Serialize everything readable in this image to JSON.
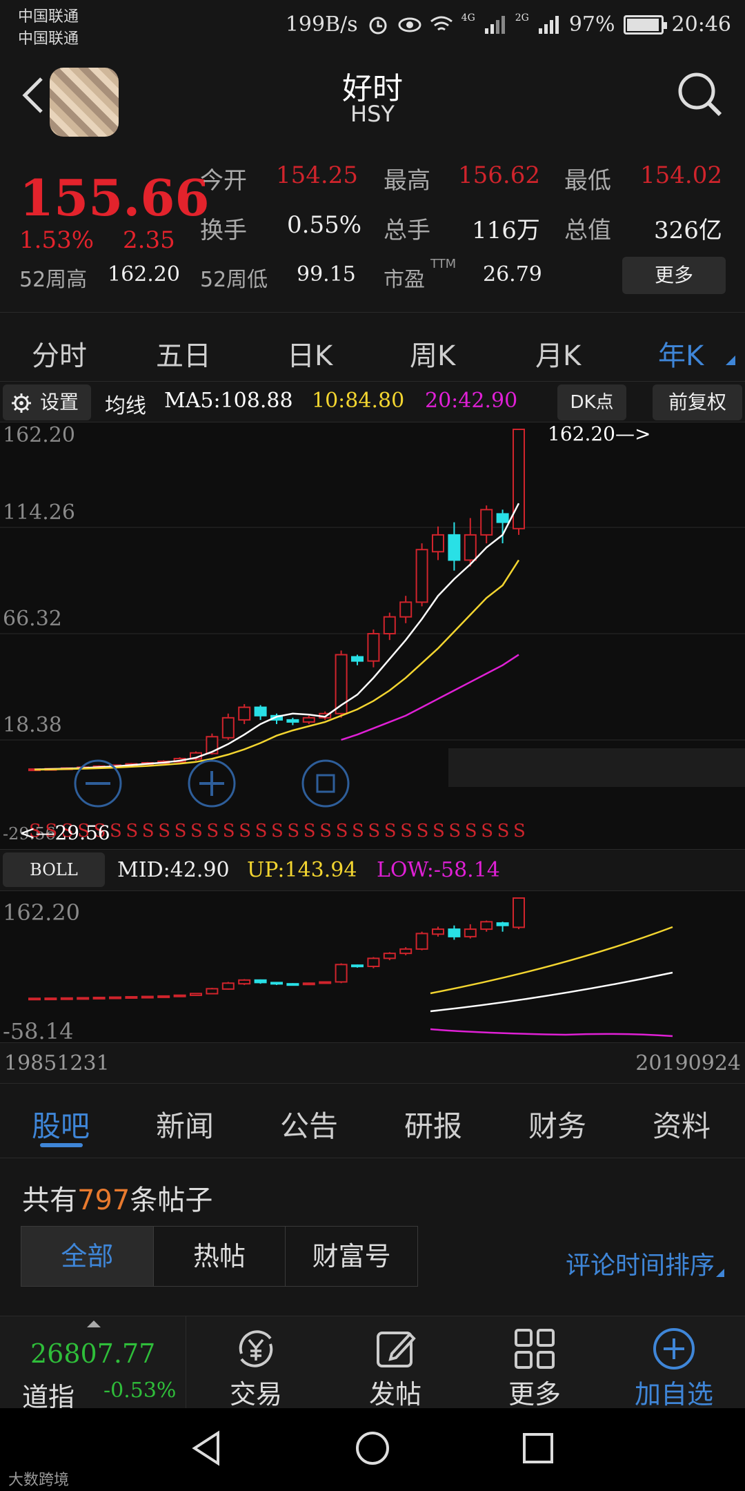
{
  "status_bar": {
    "carrier_1": "中国联通",
    "carrier_2": "中国联通",
    "speed": "199B/s",
    "network_4g": "4G",
    "network_2g": "2G",
    "battery": "97%",
    "time": "20:46"
  },
  "header": {
    "title": "好时",
    "ticker": "HSY"
  },
  "quote": {
    "price": "155.66",
    "change_pct": "1.53%",
    "change": "2.35",
    "open_label": "今开",
    "open": "154.25",
    "high_label": "最高",
    "high": "156.62",
    "low_label": "最低",
    "low": "154.02",
    "turnover_label": "换手",
    "turnover": "0.55%",
    "volume_label": "总手",
    "volume": "116万",
    "mktcap_label": "总值",
    "mktcap": "326亿",
    "w52_high_label": "52周高",
    "w52_high": "162.20",
    "w52_low_label": "52周低",
    "w52_low": "99.15",
    "pe_label": "市盈",
    "pe_sup": "TTM",
    "pe": "26.79",
    "more_label": "更多"
  },
  "period_tabs": [
    "分时",
    "五日",
    "日K",
    "周K",
    "月K",
    "年K"
  ],
  "ma_bar": {
    "settings_label": "设置",
    "ma_title": "均线",
    "ma5": "MA5:108.88",
    "ma10": "10:84.80",
    "ma20": "20:42.90",
    "dk_label": "DK点",
    "adjust_label": "前复权"
  },
  "main_chart": {
    "y_labels": [
      "162.20",
      "114.26",
      "66.32",
      "18.38",
      "-29.56"
    ],
    "max_annotation": "162.20—>",
    "min_annotation": "<—29.56",
    "signal_char": "S"
  },
  "boll_bar": {
    "button_label": "BOLL",
    "mid": "MID:42.90",
    "up": "UP:143.94",
    "low": "LOW:-58.14"
  },
  "sub_chart": {
    "y_top": "162.20",
    "y_bottom": "-58.14"
  },
  "dates": {
    "start": "19851231",
    "end": "20190924"
  },
  "news_tabs": [
    "股吧",
    "新闻",
    "公告",
    "研报",
    "财务",
    "资料"
  ],
  "posts": {
    "prefix": "共有",
    "count": "797",
    "suffix": "条帖子",
    "filters": [
      "全部",
      "热帖",
      "财富号"
    ],
    "sort_label": "评论时间排序"
  },
  "bottom_bar": {
    "index_value": "26807.77",
    "index_name": "道指",
    "index_change": "-0.53%",
    "tools": [
      "交易",
      "发帖",
      "更多",
      "加自选"
    ]
  },
  "watermark": "大数跨境",
  "colors": {
    "up": "#d0242c",
    "down": "#29e0e6",
    "accent": "#3f86d8",
    "ma5": "#ffffff",
    "ma10": "#f3d530",
    "ma20": "#e020d6"
  },
  "chart_data": {
    "type": "candlestick",
    "y_range": [
      -29.56,
      162.2
    ],
    "candles": [
      {
        "o": 0.2,
        "c": 0.6,
        "h": 0.9,
        "l": 0.0
      },
      {
        "o": 0.4,
        "c": 0.8,
        "h": 1.0,
        "l": 0.2
      },
      {
        "o": 0.7,
        "c": 1.1,
        "h": 1.4,
        "l": 0.5
      },
      {
        "o": 1.0,
        "c": 1.5,
        "h": 1.8,
        "l": 0.8
      },
      {
        "o": 1.4,
        "c": 2.0,
        "h": 2.4,
        "l": 1.2
      },
      {
        "o": 1.8,
        "c": 2.5,
        "h": 2.8,
        "l": 1.6
      },
      {
        "o": 2.3,
        "c": 3.1,
        "h": 3.5,
        "l": 2.0
      },
      {
        "o": 2.9,
        "c": 3.6,
        "h": 4.0,
        "l": 2.6
      },
      {
        "o": 3.4,
        "c": 4.3,
        "h": 4.8,
        "l": 3.1
      },
      {
        "o": 4.0,
        "c": 5.6,
        "h": 6.2,
        "l": 3.8
      },
      {
        "o": 5.4,
        "c": 8.3,
        "h": 9.0,
        "l": 4.6
      },
      {
        "o": 8.0,
        "c": 16.0,
        "h": 17.5,
        "l": 7.5
      },
      {
        "o": 15.5,
        "c": 25.0,
        "h": 27.0,
        "l": 14.5
      },
      {
        "o": 24.0,
        "c": 30.0,
        "h": 31.5,
        "l": 22.0
      },
      {
        "o": 30.0,
        "c": 26.0,
        "h": 31.0,
        "l": 24.0
      },
      {
        "o": 26.0,
        "c": 24.0,
        "h": 27.0,
        "l": 22.0
      },
      {
        "o": 24.0,
        "c": 23.0,
        "h": 25.0,
        "l": 21.5
      },
      {
        "o": 23.0,
        "c": 25.0,
        "h": 26.0,
        "l": 22.0
      },
      {
        "o": 25.0,
        "c": 27.0,
        "h": 28.0,
        "l": 24.0
      },
      {
        "o": 27.0,
        "c": 55.0,
        "h": 57.0,
        "l": 25.0
      },
      {
        "o": 54.0,
        "c": 52.0,
        "h": 55.0,
        "l": 50.0
      },
      {
        "o": 52.0,
        "c": 65.0,
        "h": 67.0,
        "l": 49.0
      },
      {
        "o": 65.0,
        "c": 73.0,
        "h": 75.0,
        "l": 62.0
      },
      {
        "o": 73.0,
        "c": 80.0,
        "h": 83.0,
        "l": 70.0
      },
      {
        "o": 80.0,
        "c": 105.0,
        "h": 108.0,
        "l": 78.0
      },
      {
        "o": 104.0,
        "c": 112.0,
        "h": 116.0,
        "l": 100.0
      },
      {
        "o": 112.0,
        "c": 100.0,
        "h": 118.0,
        "l": 95.0
      },
      {
        "o": 100.0,
        "c": 112.0,
        "h": 120.0,
        "l": 97.0
      },
      {
        "o": 112.0,
        "c": 124.0,
        "h": 126.0,
        "l": 108.0
      },
      {
        "o": 122.0,
        "c": 118.0,
        "h": 124.0,
        "l": 108.0
      },
      {
        "o": 115.0,
        "c": 162.2,
        "h": 162.2,
        "l": 112.0
      }
    ],
    "ma5": [
      0.4,
      0.6,
      0.8,
      1.1,
      1.5,
      1.9,
      2.5,
      3.1,
      3.7,
      4.6,
      6.0,
      8.8,
      12.5,
      17.0,
      22.0,
      25.5,
      27.0,
      26.5,
      25.5,
      31.0,
      36.0,
      44.0,
      53.0,
      62.0,
      72.0,
      83.0,
      91.0,
      98.0,
      106.0,
      112.0,
      127.0
    ],
    "ma10": [
      0.3,
      0.4,
      0.6,
      0.8,
      1.0,
      1.3,
      1.7,
      2.1,
      2.6,
      3.2,
      4.0,
      5.5,
      7.5,
      10.0,
      13.0,
      16.5,
      19.0,
      21.0,
      23.0,
      26.0,
      29.0,
      33.0,
      38.0,
      44.0,
      51.0,
      58.0,
      66.0,
      74.0,
      82.0,
      88.0,
      100.0
    ],
    "ma20": [
      null,
      null,
      null,
      null,
      null,
      null,
      null,
      null,
      null,
      null,
      null,
      null,
      null,
      null,
      null,
      null,
      null,
      null,
      null,
      14.5,
      17.0,
      20.0,
      23.0,
      26.0,
      30.0,
      34.0,
      38.0,
      42.0,
      46.0,
      50.0,
      55.0
    ]
  }
}
